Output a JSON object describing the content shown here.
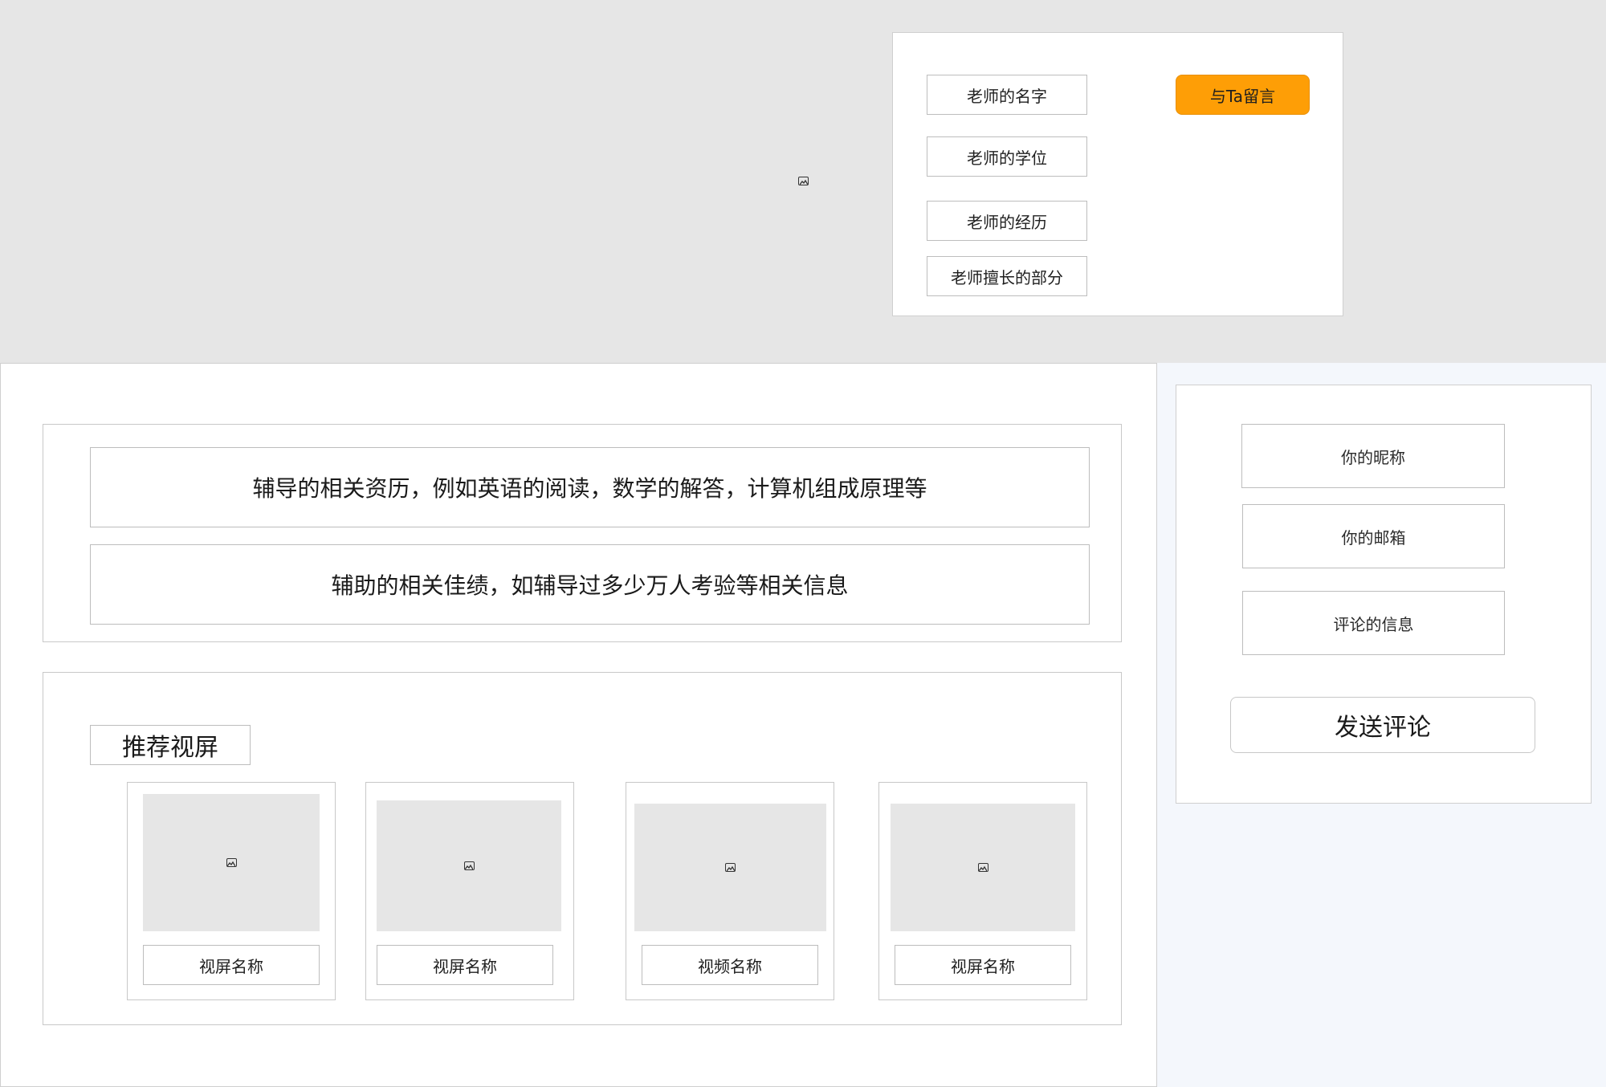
{
  "header": {
    "avatar_icon": "image-placeholder-icon",
    "teacher": {
      "name": "老师的名字",
      "degree": "老师的学位",
      "experience": "老师的经历",
      "specialty": "老师擅长的部分"
    },
    "message_button": "与Ta留言"
  },
  "main": {
    "experience_line": "辅导的相关资历，例如英语的阅读，数学的解答，计算机组成原理等",
    "achievement_line": "辅助的相关佳绩，如辅导过多少万人考验等相关信息",
    "recommend_title": "推荐视屏",
    "videos": [
      {
        "name": "视屏名称",
        "thumb_icon": "image-placeholder-icon"
      },
      {
        "name": "视屏名称",
        "thumb_icon": "image-placeholder-icon"
      },
      {
        "name": "视频名称",
        "thumb_icon": "image-placeholder-icon"
      },
      {
        "name": "视屏名称",
        "thumb_icon": "image-placeholder-icon"
      }
    ]
  },
  "comment": {
    "nickname_label": "你的昵称",
    "email_label": "你的邮箱",
    "message_label": "评论的信息",
    "send_button": "发送评论"
  },
  "colors": {
    "banner_bg": "#e6e6e6",
    "page_bg": "#f4f7fc",
    "accent": "#fe9e06",
    "placeholder": "#e6e6e6"
  }
}
